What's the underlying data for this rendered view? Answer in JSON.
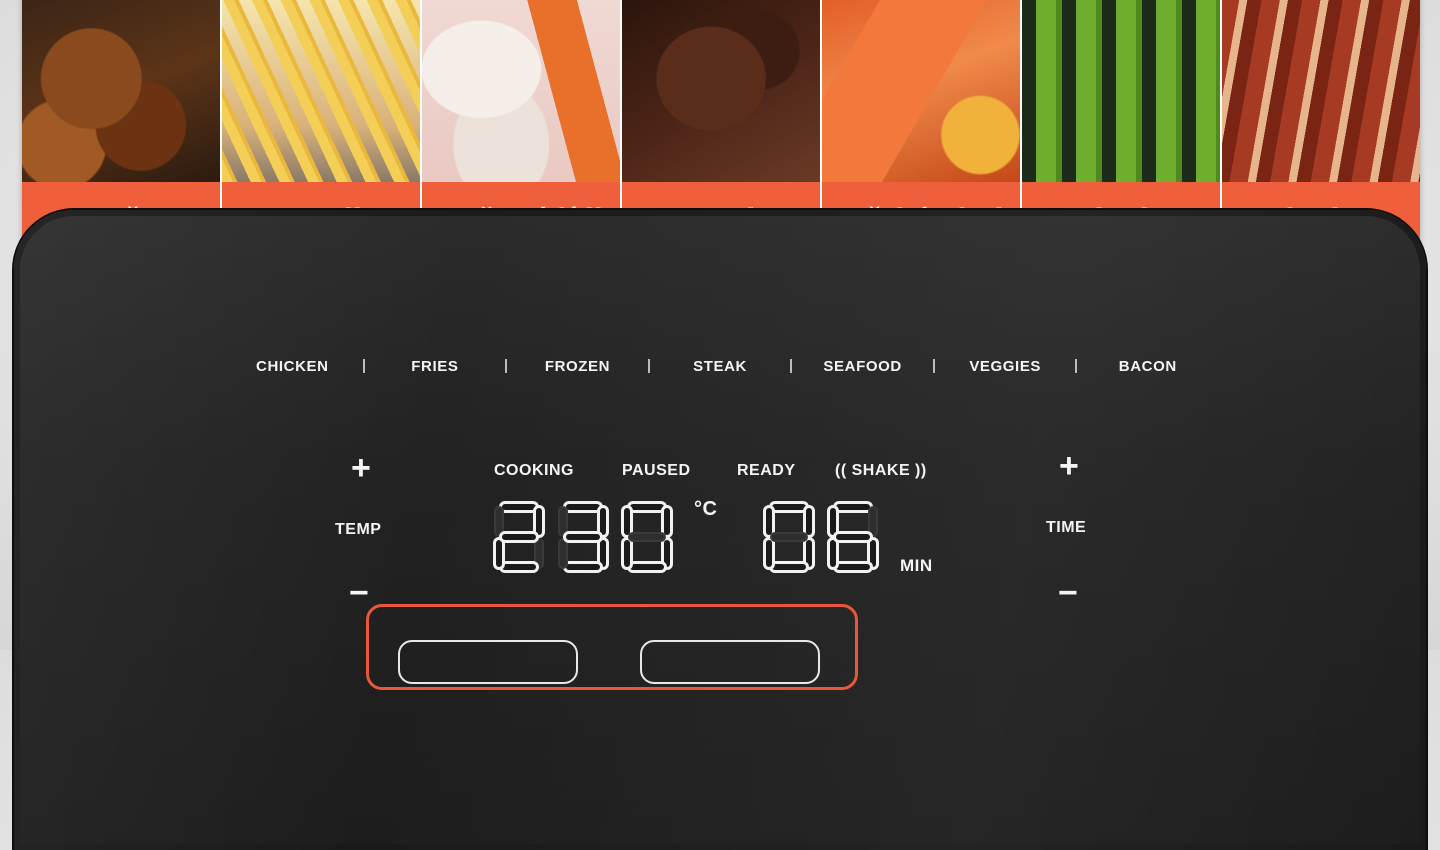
{
  "food_strip": [
    {
      "label": "Kuře"
    },
    {
      "label": "Hranolky"
    },
    {
      "label": "Mražené jídlo"
    },
    {
      "label": "Steak"
    },
    {
      "label": "Mořské plody"
    },
    {
      "label": "Zelenina"
    },
    {
      "label": "Slanina"
    }
  ],
  "presets": [
    "CHICKEN",
    "FRIES",
    "FROZEN",
    "STEAK",
    "SEAFOOD",
    "VEGGIES",
    "BACON"
  ],
  "status": {
    "cooking": "COOKING",
    "paused": "PAUSED",
    "ready": "READY",
    "shake": "(( SHAKE ))"
  },
  "temp": {
    "label": "TEMP",
    "plus": "+",
    "minus": "−",
    "value": "230",
    "unit": "°C"
  },
  "time": {
    "label": "TIME",
    "plus": "+",
    "minus": "−",
    "value": "06",
    "unit": "MIN"
  },
  "colors": {
    "accent": "#ef5f3c",
    "panel": "#222222",
    "segment": "#f2f2f2"
  }
}
